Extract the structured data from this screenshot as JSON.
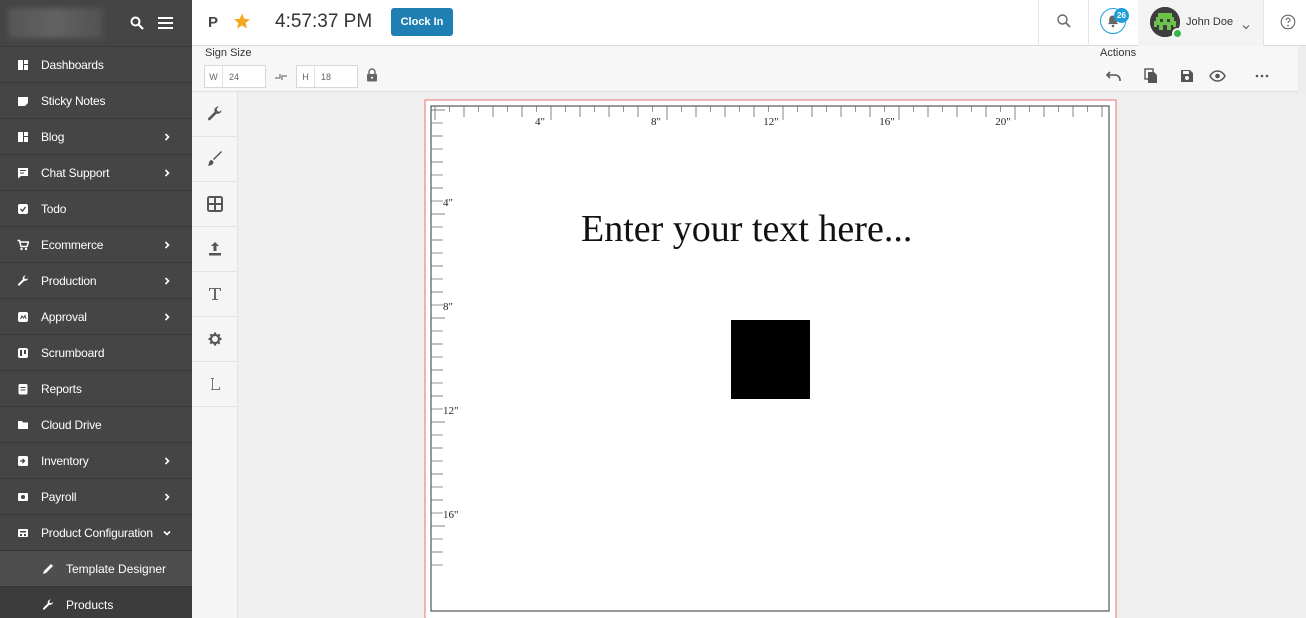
{
  "sidebar": {
    "items": [
      {
        "label": "Dashboards",
        "icon": "dashboard-icon",
        "expandable": false
      },
      {
        "label": "Sticky Notes",
        "icon": "sticky-note-icon",
        "expandable": false
      },
      {
        "label": "Blog",
        "icon": "blog-icon",
        "expandable": true
      },
      {
        "label": "Chat Support",
        "icon": "chat-icon",
        "expandable": true
      },
      {
        "label": "Todo",
        "icon": "todo-icon",
        "expandable": false
      },
      {
        "label": "Ecommerce",
        "icon": "cart-icon",
        "expandable": true
      },
      {
        "label": "Production",
        "icon": "wrench-icon",
        "expandable": true
      },
      {
        "label": "Approval",
        "icon": "approval-icon",
        "expandable": true
      },
      {
        "label": "Scrumboard",
        "icon": "scrumboard-icon",
        "expandable": false
      },
      {
        "label": "Reports",
        "icon": "reports-icon",
        "expandable": false
      },
      {
        "label": "Cloud Drive",
        "icon": "folder-icon",
        "expandable": false
      },
      {
        "label": "Inventory",
        "icon": "inventory-icon",
        "expandable": true
      },
      {
        "label": "Payroll",
        "icon": "payroll-icon",
        "expandable": true
      },
      {
        "label": "Product Configuration",
        "icon": "product-config-icon",
        "expandable": true,
        "expanded": true
      }
    ],
    "subitems": [
      {
        "label": "Template Designer",
        "icon": "pencil-icon",
        "active": true
      },
      {
        "label": "Products",
        "icon": "wrench-icon",
        "active": false
      }
    ]
  },
  "topbar": {
    "p_label": "P",
    "time": "4:57:37 PM",
    "clock_in_label": "Clock In",
    "notification_count": "26",
    "user_name": "John Doe"
  },
  "options": {
    "sign_size_label": "Sign Size",
    "width_prefix": "W",
    "width_value": "24",
    "height_prefix": "H",
    "height_value": "18",
    "actions_label": "Actions"
  },
  "canvas": {
    "text": "Enter your text here...",
    "ruler_labels_top": [
      "4\"",
      "8\"",
      "12\"",
      "16\"",
      "20\""
    ],
    "ruler_labels_left": [
      "4\"",
      "8\"",
      "12\"",
      "16\""
    ]
  },
  "colors": {
    "sidebar_bg": "#454545",
    "accent": "#1f7fb2",
    "badge": "#1f9fd9",
    "star": "#f5a623",
    "online": "#35b54a"
  }
}
